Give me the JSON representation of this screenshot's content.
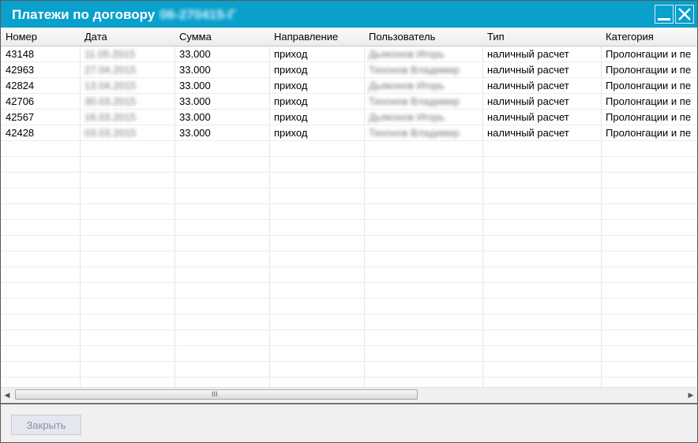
{
  "window": {
    "title": "Платежи по договору",
    "contract_number": "06-270415-Г"
  },
  "columns": [
    "Номер",
    "Дата",
    "Сумма",
    "Направление",
    "Пользователь",
    "Тип",
    "Категория"
  ],
  "rows": [
    {
      "number": "43148",
      "date": "11.05.2015",
      "amount": "33.000",
      "direction": "приход",
      "user": "Дьяконов Игорь",
      "type": "наличный расчет",
      "category": "Пролонгации и пе"
    },
    {
      "number": "42963",
      "date": "27.04.2015",
      "amount": "33.000",
      "direction": "приход",
      "user": "Тихонов Владимир",
      "type": "наличный расчет",
      "category": "Пролонгации и пе"
    },
    {
      "number": "42824",
      "date": "13.04.2015",
      "amount": "33.000",
      "direction": "приход",
      "user": "Дьяконов Игорь",
      "type": "наличный расчет",
      "category": "Пролонгации и пе"
    },
    {
      "number": "42706",
      "date": "30.03.2015",
      "amount": "33.000",
      "direction": "приход",
      "user": "Тихонов Владимир",
      "type": "наличный расчет",
      "category": "Пролонгации и пе"
    },
    {
      "number": "42567",
      "date": "16.03.2015",
      "amount": "33.000",
      "direction": "приход",
      "user": "Дьяконов Игорь",
      "type": "наличный расчет",
      "category": "Пролонгации и пе"
    },
    {
      "number": "42428",
      "date": "03.03.2015",
      "amount": "33.000",
      "direction": "приход",
      "user": "Тихонов Владимир",
      "type": "наличный расчет",
      "category": "Пролонгации и пе"
    }
  ],
  "scrollbar": {
    "grip": "III"
  },
  "footer": {
    "close_label": "Закрыть"
  },
  "icons": {
    "minimize": "minimize-icon",
    "close": "close-icon",
    "scroll_left": "arrow-left-icon",
    "scroll_right": "arrow-right-icon"
  },
  "colors": {
    "titlebar": "#0aa0cc",
    "button_text_disabled": "#8a90a0"
  }
}
